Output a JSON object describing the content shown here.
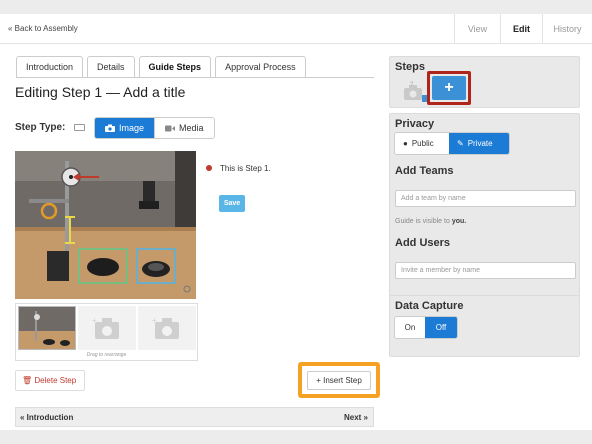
{
  "topbar": {
    "back_label": "« Back to Assembly",
    "nav": [
      {
        "label": "View",
        "active": false
      },
      {
        "label": "Edit",
        "active": true
      },
      {
        "label": "History",
        "active": false
      }
    ]
  },
  "tabs": [
    {
      "label": "Introduction",
      "active": false
    },
    {
      "label": "Details",
      "active": false
    },
    {
      "label": "Guide Steps",
      "active": true
    },
    {
      "label": "Approval Process",
      "active": false
    }
  ],
  "editor": {
    "title": "Editing Step 1 — Add a title",
    "step_type_label": "Step Type:",
    "image_label": "Image",
    "media_label": "Media",
    "drag_hint": "Drag to rearrange",
    "bullet_text": "This is Step 1.",
    "save_label": "Save",
    "delete_label": "Delete Step",
    "insert_label": "Insert Step",
    "prev_label": "« Introduction",
    "next_label": "Next »"
  },
  "sidebar": {
    "steps_heading": "Steps",
    "add_step_glyph": "+",
    "privacy_heading": "Privacy",
    "public_label": "Public",
    "private_label": "Private",
    "teams_heading": "Add Teams",
    "teams_placeholder": "Add a team by name",
    "visibility_prefix": "Guide is visible to ",
    "visibility_value": "you.",
    "users_heading": "Add Users",
    "users_placeholder": "Invite a member by name",
    "capture_heading": "Data Capture",
    "on_label": "On",
    "off_label": "Off"
  },
  "colors": {
    "primary": "#1c7bd4",
    "insert_highlight": "#f5a124",
    "add_highlight": "#b0241a",
    "delete": "#c0392b"
  }
}
